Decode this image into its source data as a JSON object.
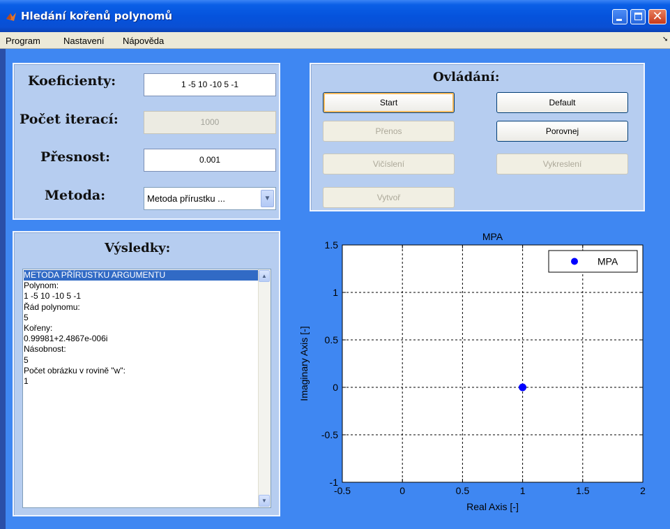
{
  "window": {
    "title": "Hledání kořenů polynomů",
    "controls": {
      "minimize": "minimize-icon",
      "maximize": "maximize-icon",
      "close": "close-icon"
    }
  },
  "menu": {
    "items": [
      "Program",
      "Nastavení",
      "Nápověda"
    ]
  },
  "params": {
    "koeficienty_label": "Koeficienty:",
    "koeficienty_value": "1 -5 10 -10 5 -1",
    "iterace_label": "Počet iterací:",
    "iterace_value": "1000",
    "presnost_label": "Přesnost:",
    "presnost_value": "0.001",
    "metoda_label": "Metoda:",
    "metoda_value": "Metoda přírustku ..."
  },
  "controls": {
    "title": "Ovládání:",
    "start": "Start",
    "default": "Default",
    "prenos": "Přenos",
    "porovnej": "Porovnej",
    "vycisleni": "Vičíslení",
    "vykresleni": "Vykreslení",
    "vytvor": "Vytvoř"
  },
  "results": {
    "title": "Výsledky:",
    "lines": [
      "METODA PŘÍRUSTKU ARGUMENTU",
      "Polynom:",
      "1  -5  10 -10   5  -1",
      "Řád polynomu:",
      "5",
      "Kořeny:",
      "0.99981+2.4867e-006i",
      "Násobnost:",
      "5",
      "Počet obrázku v rovině \"w\":",
      "1"
    ]
  },
  "colors": {
    "marker": "#0000ff",
    "selection": "#316ac5",
    "panel": "#b6cdf0",
    "background": "#3f87f2"
  },
  "chart_data": {
    "type": "scatter",
    "title": "MPA",
    "xlabel": "Real Axis [-]",
    "ylabel": "Imaginary Axis [-]",
    "xlim": [
      -0.5,
      2
    ],
    "ylim": [
      -1,
      1.5
    ],
    "xticks": [
      -0.5,
      0,
      0.5,
      1,
      1.5,
      2
    ],
    "xtick_labels": [
      "-0.5",
      "0",
      "0.5",
      "1",
      "1.5",
      "2"
    ],
    "yticks": [
      -1,
      -0.5,
      0,
      0.5,
      1,
      1.5
    ],
    "ytick_labels": [
      "-1",
      "-0.5",
      "0",
      "0.5",
      "1",
      "1.5"
    ],
    "grid": true,
    "legend": "top-right",
    "series": [
      {
        "name": "MPA",
        "color": "#0000ff",
        "points": [
          {
            "x": 0.99981,
            "y": 2.4867e-06
          }
        ]
      }
    ]
  }
}
